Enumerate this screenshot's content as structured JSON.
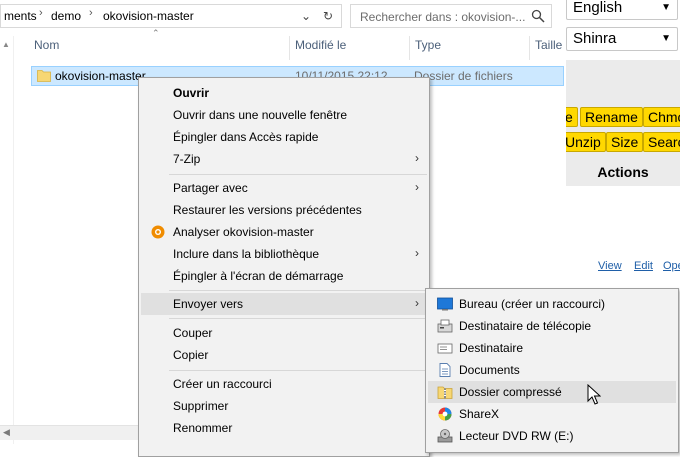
{
  "explorer": {
    "breadcrumb": [
      "ments",
      "demo",
      "okovision-master"
    ],
    "search_placeholder": "Rechercher dans : okovision-...",
    "columns": {
      "name": "Nom",
      "modified": "Modifié le",
      "type": "Type",
      "size": "Taille"
    },
    "file": {
      "name": "okovision-master",
      "date": "10/11/2015 22:12",
      "type": "Dossier de fichiers"
    }
  },
  "context_menu": {
    "open": "Ouvrir",
    "open_new_window": "Ouvrir dans une nouvelle fenêtre",
    "pin_quick_access": "Épingler dans Accès rapide",
    "seven_zip": "7-Zip",
    "share_with": "Partager avec",
    "restore_previous": "Restaurer les versions précédentes",
    "analyze": "Analyser okovision-master",
    "include_library": "Inclure dans la bibliothèque",
    "pin_start": "Épingler à l'écran de démarrage",
    "send_to": "Envoyer vers",
    "cut": "Couper",
    "copy": "Copier",
    "create_shortcut": "Créer un raccourci",
    "delete": "Supprimer",
    "rename": "Renommer"
  },
  "send_to_menu": {
    "desktop": "Bureau (créer un raccourci)",
    "fax": "Destinataire de télécopie",
    "mail": "Destinataire",
    "documents": "Documents",
    "compressed": "Dossier compressé",
    "sharex": "ShareX",
    "dvd": "Lecteur DVD RW (E:)"
  },
  "webpage": {
    "language": "English",
    "theme": "Shinra",
    "buttons": {
      "e": "e",
      "rename": "Rename",
      "chmod": "Chmo",
      "unzip": "Unzip",
      "size": "Size",
      "search": "Searc"
    },
    "actions_heading": "Actions",
    "links": {
      "view": "View",
      "edit": "Edit",
      "open": "Ope"
    }
  }
}
